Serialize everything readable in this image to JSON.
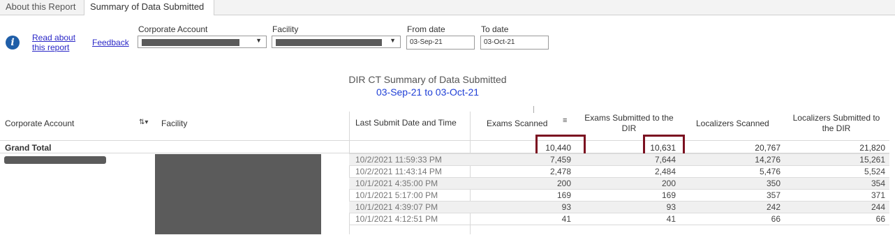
{
  "tabs": [
    {
      "label": "About this Report"
    },
    {
      "label": "Summary of Data Submitted"
    }
  ],
  "filters": {
    "info_icon": "info-icon",
    "read_link": "Read about this report",
    "feedback_link": "Feedback",
    "corporate_account_label": "Corporate Account",
    "facility_label": "Facility",
    "from_date_label": "From date",
    "from_date_value": "03-Sep-21",
    "to_date_label": "To date",
    "to_date_value": "03-Oct-21"
  },
  "report": {
    "title": "DIR CT Summary of Data Submitted",
    "subtitle": "03-Sep-21  to 03-Oct-21"
  },
  "table": {
    "headers": {
      "corporate_account": "Corporate Account",
      "facility": "Facility",
      "last_submit": "Last Submit Date and Time",
      "exams_scanned": "Exams Scanned",
      "exams_submitted": "Exams Submitted to the DIR",
      "localizers_scanned": "Localizers Scanned",
      "localizers_submitted": "Localizers Submitted to the DIR"
    },
    "sort_icon": "sort-ascending-icon",
    "sort_lines_icon": "sort-descending-icon",
    "grand_total": {
      "label": "Grand Total",
      "exams_scanned": "10,440",
      "exams_submitted": "10,631",
      "localizers_scanned": "20,767",
      "localizers_submitted": "21,820"
    },
    "rows": [
      {
        "date": "10/2/2021 11:59:33 PM",
        "exams_scanned": "7,459",
        "exams_submitted": "7,644",
        "localizers_scanned": "14,276",
        "localizers_submitted": "15,261"
      },
      {
        "date": "10/2/2021 11:43:14 PM",
        "exams_scanned": "2,478",
        "exams_submitted": "2,484",
        "localizers_scanned": "5,476",
        "localizers_submitted": "5,524"
      },
      {
        "date": "10/1/2021 4:35:00 PM",
        "exams_scanned": "200",
        "exams_submitted": "200",
        "localizers_scanned": "350",
        "localizers_submitted": "354"
      },
      {
        "date": "10/1/2021 5:17:00 PM",
        "exams_scanned": "169",
        "exams_submitted": "169",
        "localizers_scanned": "357",
        "localizers_submitted": "371"
      },
      {
        "date": "10/1/2021 4:39:07 PM",
        "exams_scanned": "93",
        "exams_submitted": "93",
        "localizers_scanned": "242",
        "localizers_submitted": "244"
      },
      {
        "date": "10/1/2021 4:12:51 PM",
        "exams_scanned": "41",
        "exams_submitted": "41",
        "localizers_scanned": "66",
        "localizers_submitted": "66"
      }
    ]
  },
  "colors": {
    "link": "#2a27c7",
    "subtitle": "#1f3fd6",
    "highlight_box": "#7b1020",
    "redaction": "#5b5b5b"
  }
}
